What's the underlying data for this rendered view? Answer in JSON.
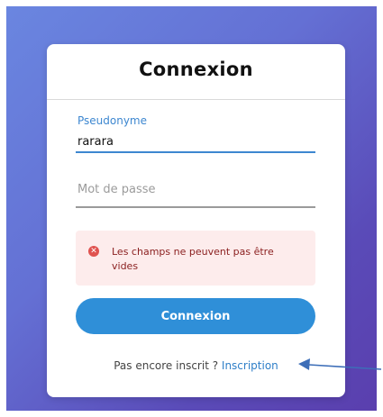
{
  "login": {
    "title": "Connexion",
    "username": {
      "label": "Pseudonyme",
      "value": "rarara"
    },
    "password": {
      "placeholder": "Mot de passe",
      "value": ""
    },
    "error": {
      "icon": "x-circle-icon",
      "message": "Les champs ne peuvent pas être vides"
    },
    "submit_label": "Connexion",
    "signup": {
      "prompt": "Pas encore inscrit ?",
      "link_label": "Inscription"
    }
  },
  "colors": {
    "accent": "#2f8fd8",
    "error_bg": "#fdecec",
    "error_text": "#8a1e1e",
    "arrow": "#3d6eb8"
  }
}
